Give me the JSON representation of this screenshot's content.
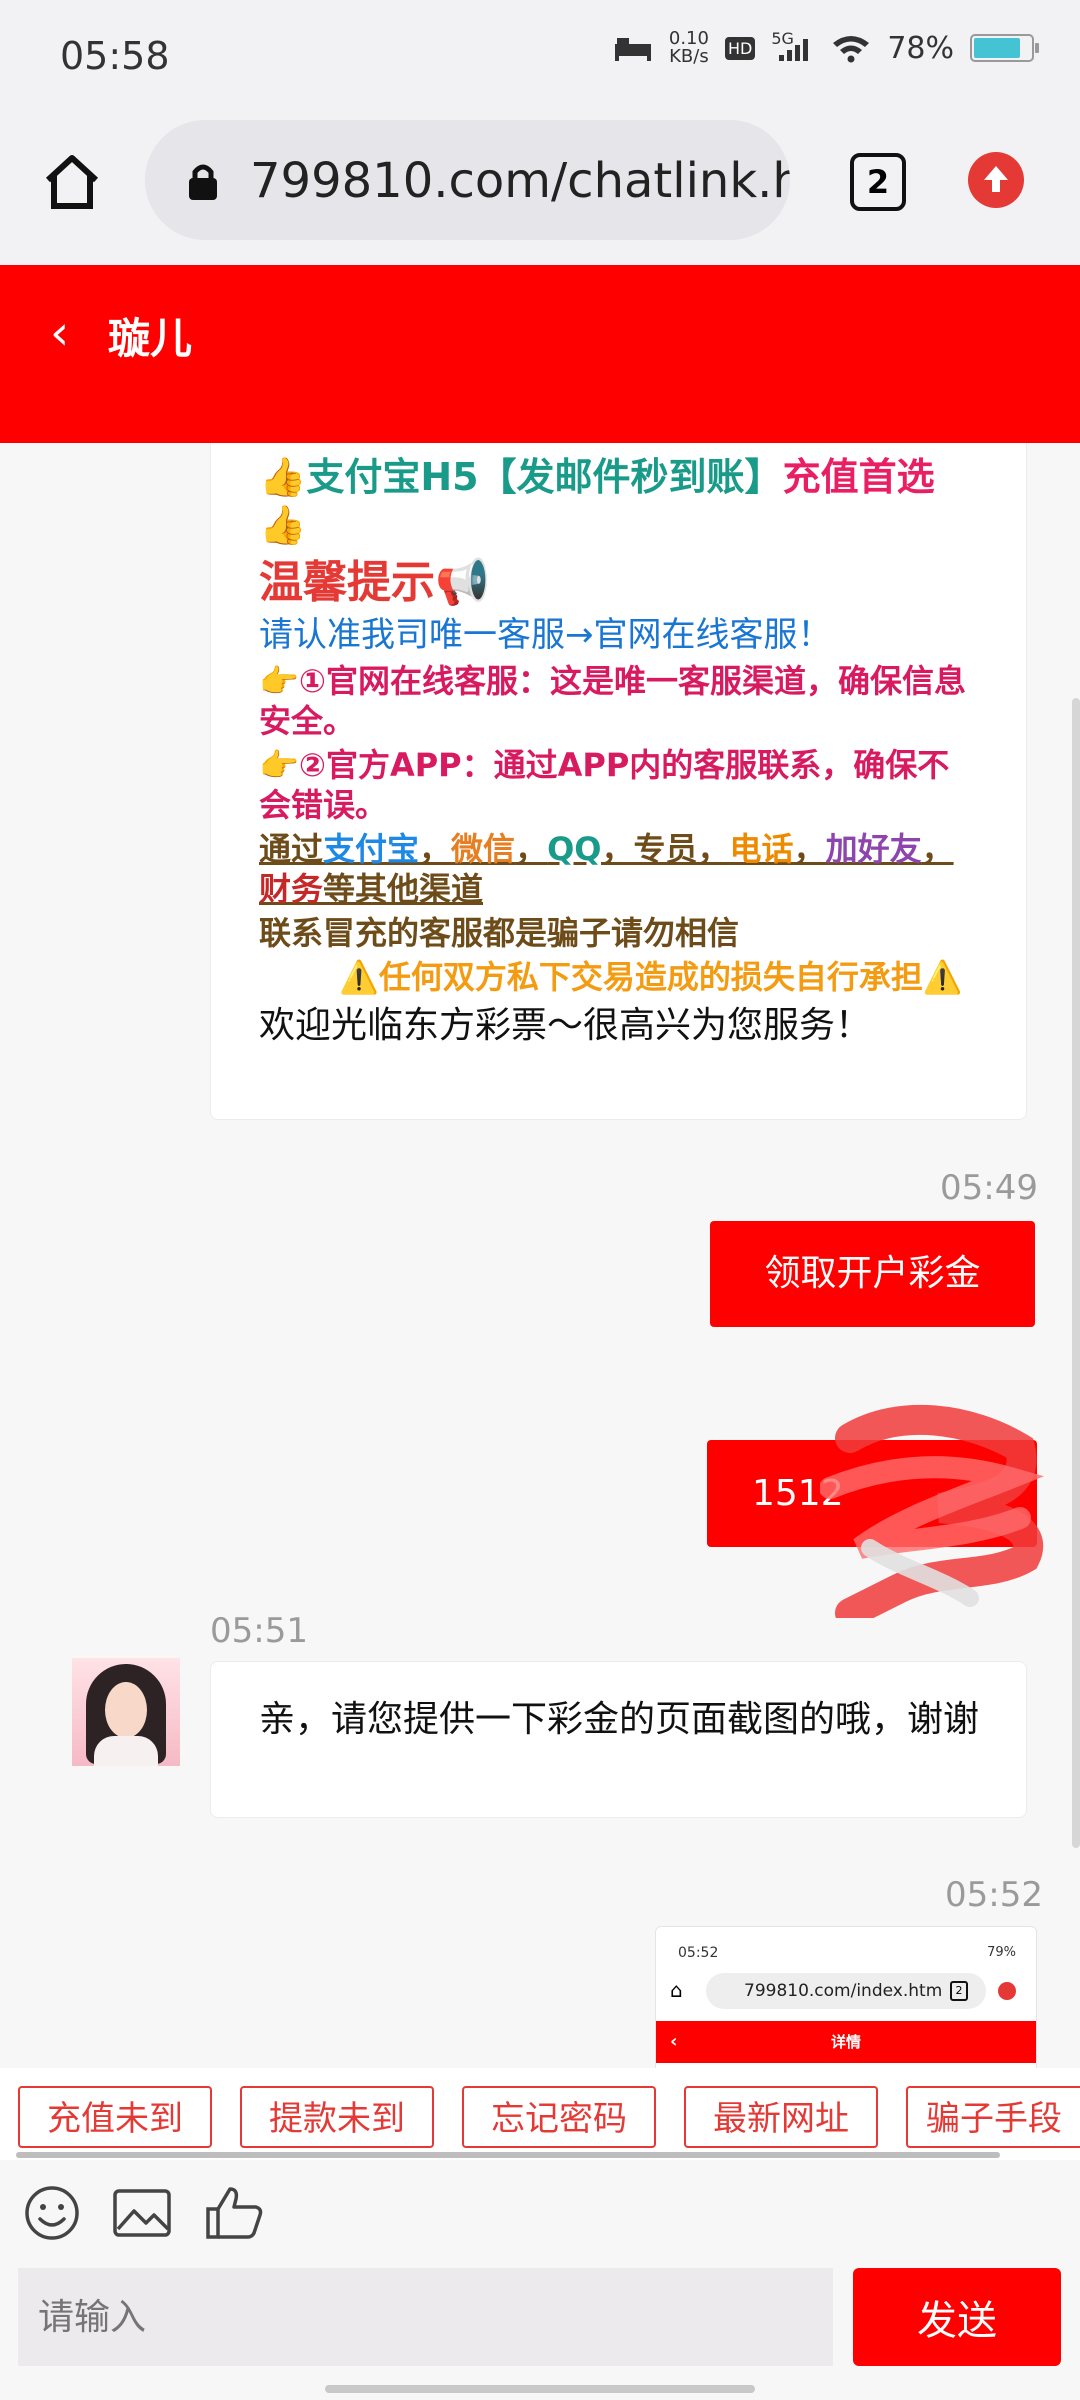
{
  "status_bar": {
    "time": "05:58",
    "network_speed_top": "0.10",
    "network_speed_bottom": "KB/s",
    "hd_label": "HD",
    "signal_label": "5G",
    "battery": "78%"
  },
  "browser": {
    "url": "799810.com/chatlink.ht",
    "tab_count": "2"
  },
  "header": {
    "back_label": "‹",
    "title": "璇儿"
  },
  "notice": {
    "line1_prefix": "👍支付宝H5【发邮件秒到账】",
    "line1_highlight": "充值首选👍",
    "line2": "温馨提示📢",
    "line3": "请认准我司唯一客服→官网在线客服！",
    "line4": "👉①官网在线客服：这是唯一客服渠道，确保信息安全。",
    "line5": "👉②官方APP：通过APP内的客服联系，确保不会错误。",
    "line6_parts": [
      "通过",
      "支付宝",
      "，",
      "微信",
      "，",
      "QQ",
      "，",
      "专员",
      "，",
      "电话",
      "，",
      "加好友",
      "，",
      "财务",
      "等其他渠道"
    ],
    "line7": "联系冒充的客服都是骗子请勿相信",
    "line8": "⚠️任何双方私下交易造成的损失自行承担⚠️",
    "line9": "欢迎光临东方彩票～很高兴为您服务！"
  },
  "messages": {
    "ts1": "05:49",
    "user_msg1": "领取开户彩金",
    "user_msg2": "1512",
    "ts2": "05:51",
    "agent_msg": "亲，请您提供一下彩金的页面截图的哦，谢谢",
    "ts3": "05:52"
  },
  "screenshot_thumb": {
    "time": "05:52",
    "status": "79%",
    "url": "799810.com/index.htm",
    "tab_count": "2",
    "header_title": "详情",
    "back": "‹"
  },
  "quick_replies": [
    "充值未到",
    "提款未到",
    "忘记密码",
    "最新网址",
    "骗子手段"
  ],
  "composer": {
    "placeholder": "请输入",
    "send_label": "发送"
  },
  "colors": {
    "brand_red": "#fe0000",
    "accent_teal": "#1a9b8a",
    "accent_pink": "#d81b60"
  }
}
